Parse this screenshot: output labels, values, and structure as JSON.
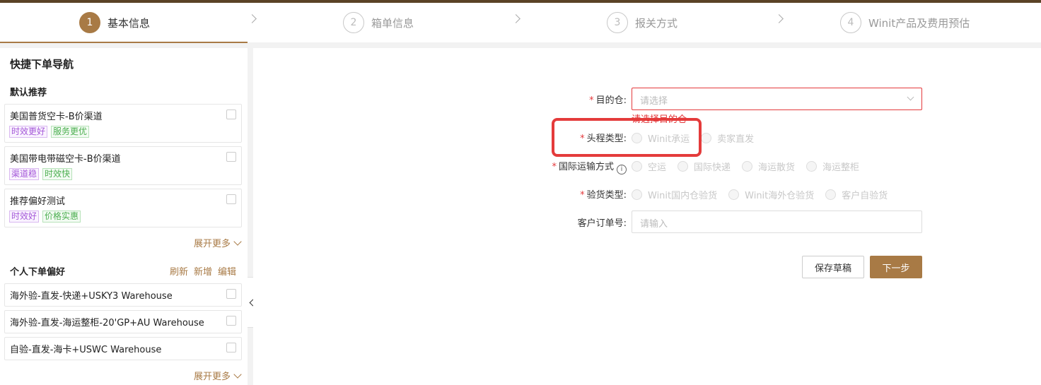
{
  "steps": [
    {
      "num": "1",
      "label": "基本信息"
    },
    {
      "num": "2",
      "label": "箱单信息"
    },
    {
      "num": "3",
      "label": "报关方式"
    },
    {
      "num": "4",
      "label": "Winit产品及费用预估"
    }
  ],
  "sidebar": {
    "title": "快捷下单导航",
    "recommend_title": "默认推荐",
    "recommend": [
      {
        "name": "美国普货空卡-B价渠道",
        "tags": [
          "时效更好",
          "服务更优"
        ]
      },
      {
        "name": "美国带电带磁空卡-B价渠道",
        "tags": [
          "渠道稳",
          "时效快"
        ]
      },
      {
        "name": "推荐偏好测试",
        "tags": [
          "时效好",
          "价格实惠"
        ]
      }
    ],
    "expand_more": "展开更多",
    "personal_title": "个人下单偏好",
    "actions": {
      "refresh": "刷新",
      "add": "新增",
      "edit": "编辑"
    },
    "personal": [
      {
        "name": "海外验-直发-快递+USKY3 Warehouse"
      },
      {
        "name": "海外验-直发-海运整柜-20'GP+AU Warehouse"
      },
      {
        "name": "自验-直发-海卡+USWC Warehouse"
      }
    ]
  },
  "form": {
    "warehouse": {
      "label": "目的仓:",
      "placeholder": "请选择",
      "error": "请选择目的仓"
    },
    "first_leg": {
      "label": "头程类型:",
      "options": [
        "Winit承运",
        "卖家直发"
      ]
    },
    "intl_transport": {
      "label": "国际运输方式",
      "info": "i",
      "options": [
        "空运",
        "国际快递",
        "海运散货",
        "海运整柜"
      ]
    },
    "inspection": {
      "label": "验货类型:",
      "options": [
        "Winit国内仓验货",
        "Winit海外仓验货",
        "客户自验货"
      ]
    },
    "order_no": {
      "label": "客户订单号:",
      "placeholder": "请输入"
    },
    "required_mark": "*",
    "save_draft": "保存草稿",
    "next": "下一步"
  },
  "colors": {
    "accent": "#a87a45",
    "error": "#e4393c",
    "highlight": "#e43b3b"
  }
}
